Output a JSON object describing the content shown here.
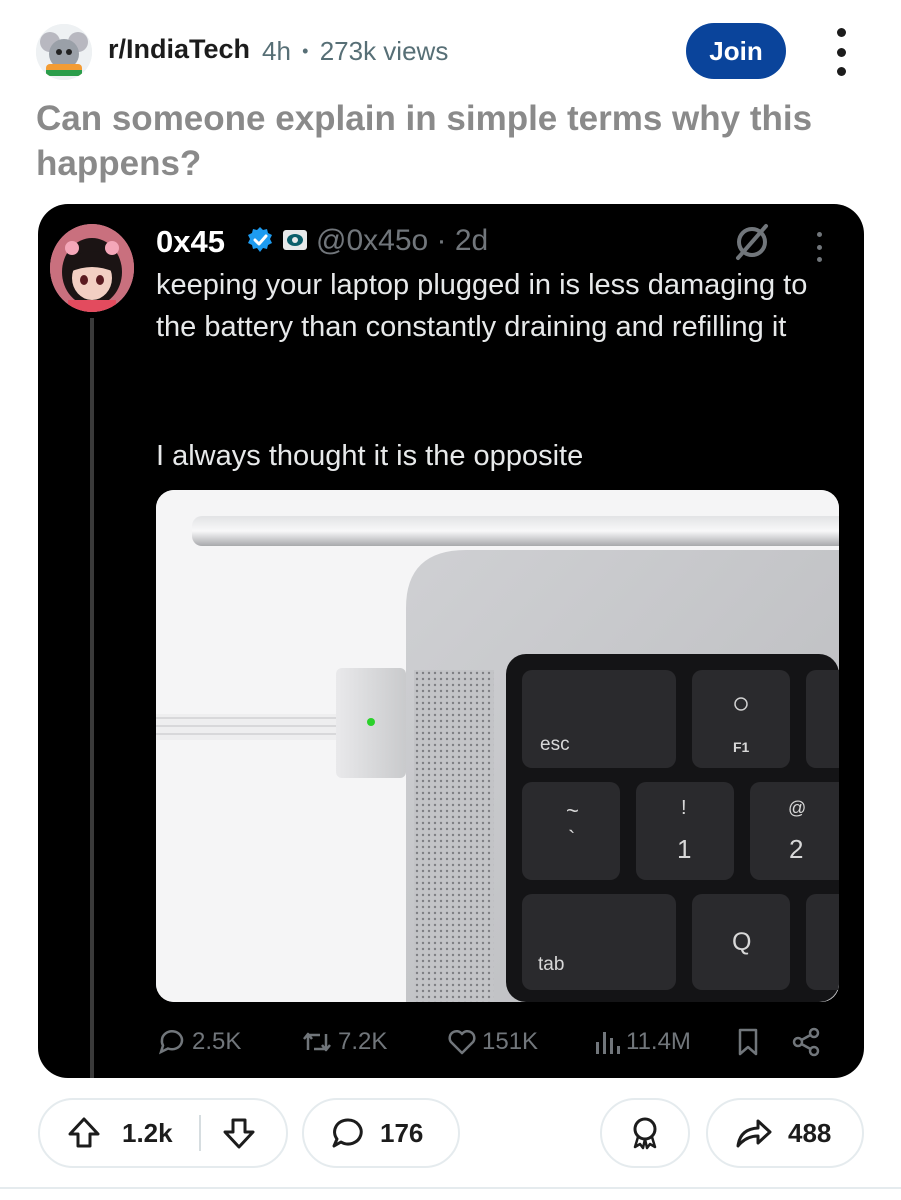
{
  "header": {
    "subreddit": "r/IndiaTech",
    "age": "4h",
    "separator": "•",
    "views": "273k views",
    "join_label": "Join"
  },
  "post": {
    "title": "Can someone explain in simple terms why this happens?"
  },
  "tweet": {
    "name": "0x45",
    "handle": "@0x45o · 2d",
    "text": "keeping your laptop plugged in is less damaging to the battery than constantly draining and refilling it",
    "text2": "I always thought it is the opposite",
    "keys": {
      "esc": "esc",
      "f1": "F1",
      "tilde": "~",
      "backtick": "`",
      "excl": "!",
      "one": "1",
      "at": "@",
      "two": "2",
      "tab": "tab",
      "q": "Q"
    },
    "stats": {
      "replies": "2.5K",
      "retweets": "7.2K",
      "likes": "151K",
      "views": "11.4M"
    }
  },
  "actions": {
    "upvotes": "1.2k",
    "comments": "176",
    "shares": "488"
  },
  "colors": {
    "join_bg": "#0a449b",
    "card_bg": "#000000",
    "verified": "#1d9bf0",
    "title_gray": "#8a8a8a",
    "meta_gray": "#576f76"
  }
}
